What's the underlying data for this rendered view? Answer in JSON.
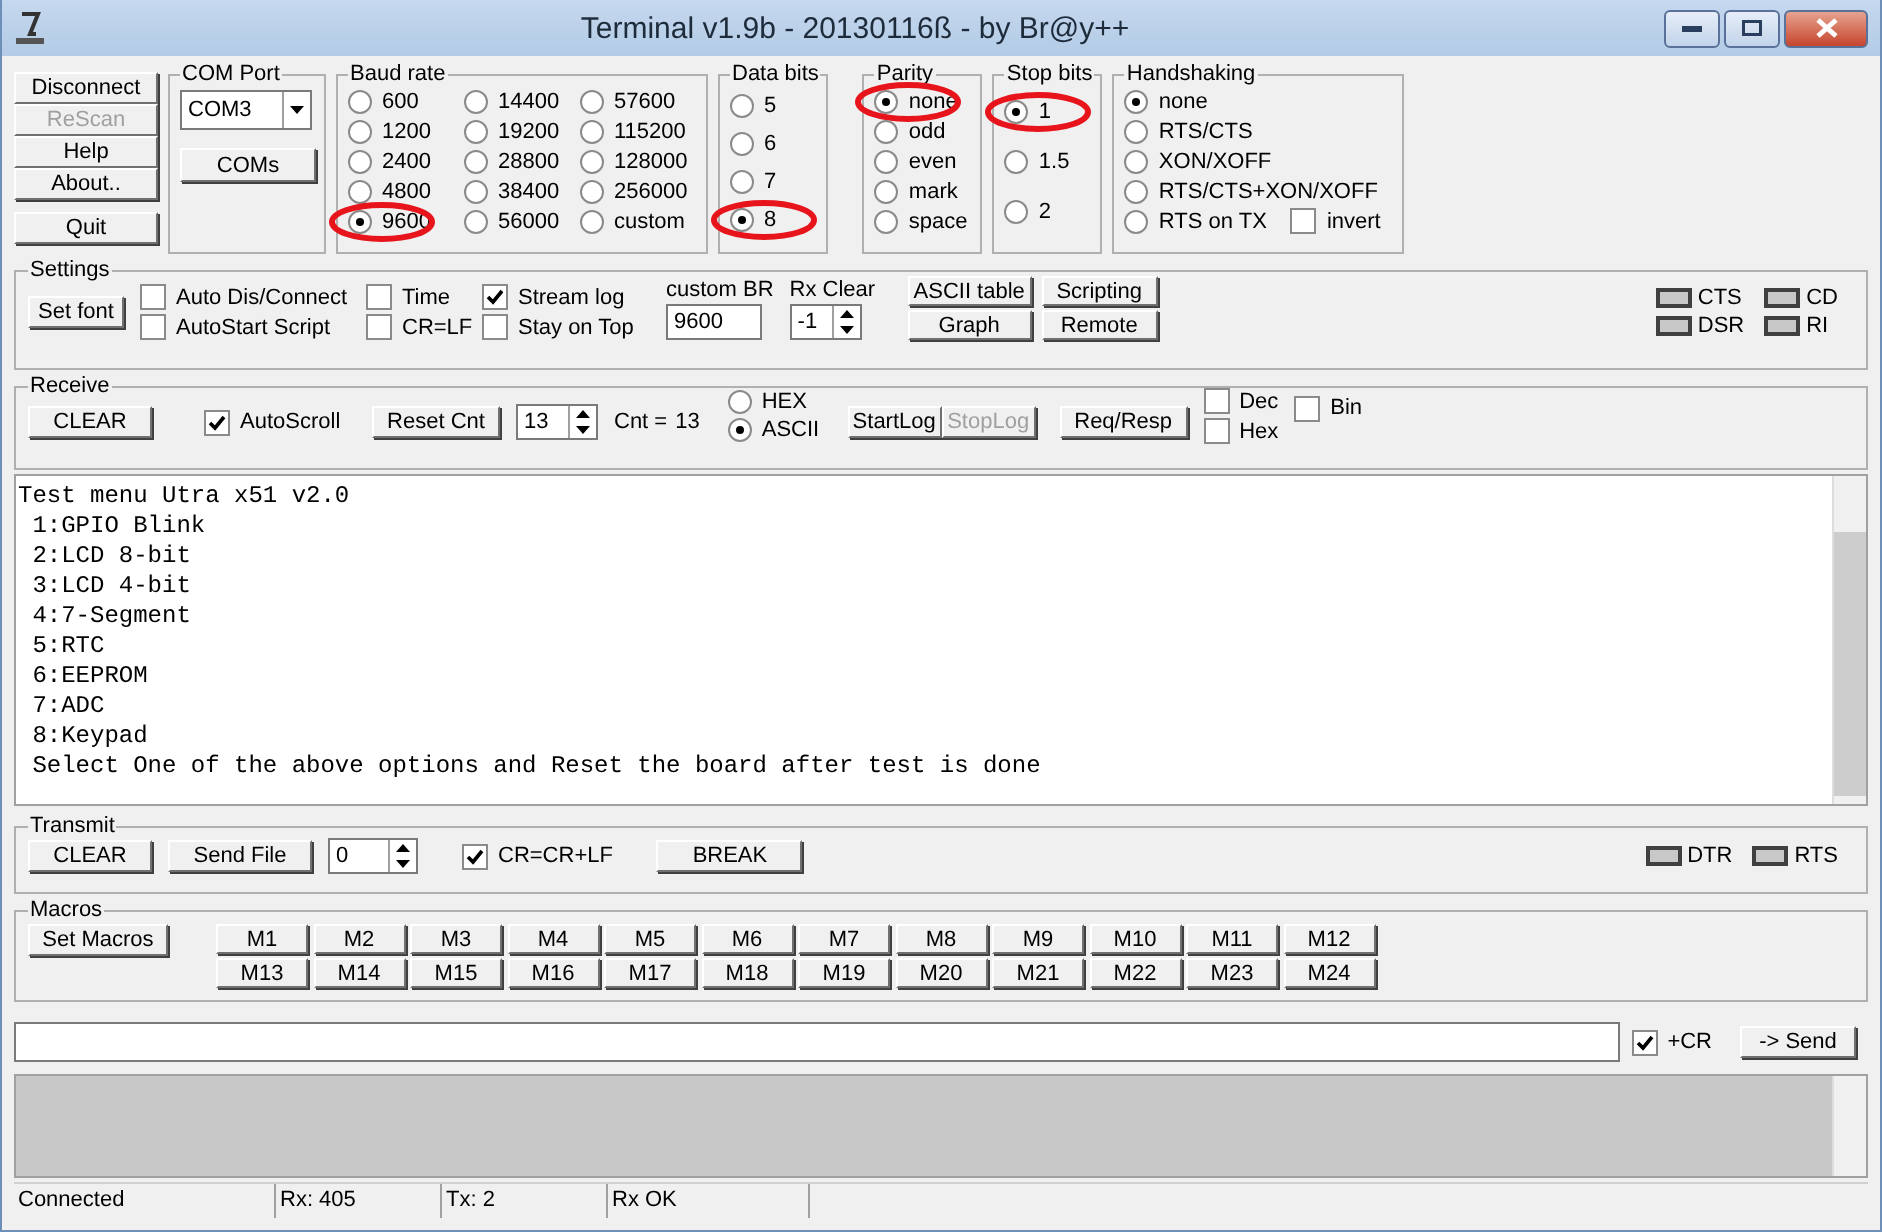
{
  "window": {
    "title": "Terminal v1.9b - 20130116ß - by Br@y++"
  },
  "side_buttons": [
    {
      "label": "Disconnect",
      "disabled": false
    },
    {
      "label": "ReScan",
      "disabled": true
    },
    {
      "label": "Help",
      "disabled": false
    },
    {
      "label": "About..",
      "disabled": false
    }
  ],
  "quit_button": "Quit",
  "com_port": {
    "title": "COM Port",
    "value": "COM3",
    "button": "COMs"
  },
  "baud_rate": {
    "title": "Baud rate",
    "options": [
      {
        "label": "600",
        "selected": false,
        "circled": false
      },
      {
        "label": "1200",
        "selected": false,
        "circled": false
      },
      {
        "label": "2400",
        "selected": false,
        "circled": false
      },
      {
        "label": "4800",
        "selected": false,
        "circled": false
      },
      {
        "label": "9600",
        "selected": true,
        "circled": true
      },
      {
        "label": "14400",
        "selected": false,
        "circled": false
      },
      {
        "label": "19200",
        "selected": false,
        "circled": false
      },
      {
        "label": "28800",
        "selected": false,
        "circled": false
      },
      {
        "label": "38400",
        "selected": false,
        "circled": false
      },
      {
        "label": "56000",
        "selected": false,
        "circled": false
      },
      {
        "label": "57600",
        "selected": false,
        "circled": false
      },
      {
        "label": "115200",
        "selected": false,
        "circled": false
      },
      {
        "label": "128000",
        "selected": false,
        "circled": false
      },
      {
        "label": "256000",
        "selected": false,
        "circled": false
      },
      {
        "label": "custom",
        "selected": false,
        "circled": false
      }
    ]
  },
  "data_bits": {
    "title": "Data bits",
    "options": [
      {
        "label": "5",
        "selected": false,
        "circled": false
      },
      {
        "label": "6",
        "selected": false,
        "circled": false
      },
      {
        "label": "7",
        "selected": false,
        "circled": false
      },
      {
        "label": "8",
        "selected": true,
        "circled": true
      }
    ]
  },
  "parity": {
    "title": "Parity",
    "options": [
      {
        "label": "none",
        "selected": true,
        "circled": true
      },
      {
        "label": "odd",
        "selected": false,
        "circled": false
      },
      {
        "label": "even",
        "selected": false,
        "circled": false
      },
      {
        "label": "mark",
        "selected": false,
        "circled": false
      },
      {
        "label": "space",
        "selected": false,
        "circled": false
      }
    ]
  },
  "stop_bits": {
    "title": "Stop bits",
    "options": [
      {
        "label": "1",
        "selected": true,
        "circled": true
      },
      {
        "label": "1.5",
        "selected": false,
        "circled": false
      },
      {
        "label": "2",
        "selected": false,
        "circled": false
      }
    ]
  },
  "handshaking": {
    "title": "Handshaking",
    "options": [
      {
        "label": "none",
        "selected": true
      },
      {
        "label": "RTS/CTS",
        "selected": false
      },
      {
        "label": "XON/XOFF",
        "selected": false
      },
      {
        "label": "RTS/CTS+XON/XOFF",
        "selected": false
      },
      {
        "label": "RTS on TX",
        "selected": false
      }
    ],
    "invert": {
      "label": "invert",
      "checked": false
    }
  },
  "settings": {
    "title": "Settings",
    "set_font": "Set font",
    "checkboxes": [
      {
        "label": "Auto Dis/Connect",
        "checked": false
      },
      {
        "label": "AutoStart Script",
        "checked": false
      },
      {
        "label": "Time",
        "checked": false
      },
      {
        "label": "CR=LF",
        "checked": false
      },
      {
        "label": "Stream log",
        "checked": true
      },
      {
        "label": "Stay on Top",
        "checked": false
      }
    ],
    "custom_br": {
      "label": "custom BR",
      "value": "9600"
    },
    "rx_clear": {
      "label": "Rx Clear",
      "value": "-1"
    },
    "buttons": [
      "ASCII table",
      "Scripting",
      "Graph",
      "Remote"
    ],
    "leds": [
      {
        "label": "CTS",
        "on": false
      },
      {
        "label": "CD",
        "on": false
      },
      {
        "label": "DSR",
        "on": false
      },
      {
        "label": "RI",
        "on": false
      }
    ]
  },
  "receive": {
    "title": "Receive",
    "clear": "CLEAR",
    "autoscroll": {
      "label": "AutoScroll",
      "checked": true
    },
    "reset_cnt": "Reset Cnt",
    "spinner": "13",
    "cnt_label": "Cnt =",
    "cnt_value": "13",
    "mode": [
      {
        "label": "HEX",
        "selected": false
      },
      {
        "label": "ASCII",
        "selected": true
      }
    ],
    "start_log": {
      "label": "StartLog",
      "disabled": false
    },
    "stop_log": {
      "label": "StopLog",
      "disabled": true
    },
    "req_resp": "Req/Resp",
    "checkboxes": [
      {
        "label": "Dec",
        "checked": false
      },
      {
        "label": "Hex",
        "checked": false
      },
      {
        "label": "Bin",
        "checked": false
      }
    ]
  },
  "terminal_lines": [
    "Test menu Utra x51 v2.0",
    " 1:GPIO Blink",
    " 2:LCD 8-bit",
    " 3:LCD 4-bit",
    " 4:7-Segment",
    " 5:RTC",
    " 6:EEPROM",
    " 7:ADC",
    " 8:Keypad",
    " Select One of the above options and Reset the board after test is done"
  ],
  "transmit": {
    "title": "Transmit",
    "clear": "CLEAR",
    "send_file": "Send File",
    "spinner": "0",
    "crlf": {
      "label": "CR=CR+LF",
      "checked": true
    },
    "break": "BREAK",
    "leds": [
      {
        "label": "DTR",
        "on": false
      },
      {
        "label": "RTS",
        "on": false
      }
    ]
  },
  "macros": {
    "title": "Macros",
    "set_macros": "Set Macros",
    "items": [
      "M1",
      "M2",
      "M3",
      "M4",
      "M5",
      "M6",
      "M7",
      "M8",
      "M9",
      "M10",
      "M11",
      "M12",
      "M13",
      "M14",
      "M15",
      "M16",
      "M17",
      "M18",
      "M19",
      "M20",
      "M21",
      "M22",
      "M23",
      "M24"
    ]
  },
  "send_row": {
    "plus_cr": {
      "label": "+CR",
      "checked": true
    },
    "send": "-> Send"
  },
  "status_bar": [
    "Connected",
    "Rx: 405",
    "Tx: 2",
    "Rx OK"
  ]
}
